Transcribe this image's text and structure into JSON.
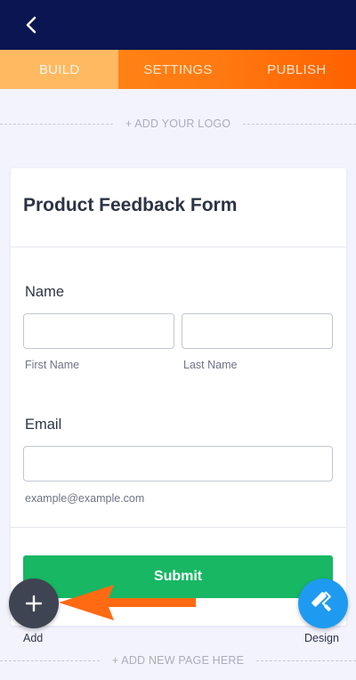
{
  "tabs": [
    {
      "label": "BUILD",
      "active": true
    },
    {
      "label": "SETTINGS",
      "active": false
    },
    {
      "label": "PUBLISH",
      "active": false
    }
  ],
  "logo_placeholder": "+ ADD YOUR LOGO",
  "form": {
    "title": "Product Feedback Form",
    "name_field": {
      "label": "Name",
      "first_value": "",
      "last_value": "",
      "first_sublabel": "First Name",
      "last_sublabel": "Last Name"
    },
    "email_field": {
      "label": "Email",
      "value": "",
      "sublabel": "example@example.com"
    },
    "submit_label": "Submit"
  },
  "fabs": {
    "add_label": "Add",
    "design_label": "Design"
  },
  "new_page_placeholder": "+ ADD NEW PAGE HERE",
  "colors": {
    "header_bg": "#0a1551",
    "tab_gradient_start": "#ff8c1a",
    "tab_gradient_end": "#ff6100",
    "active_tab_bg": "#ffb961",
    "submit_green": "#18b764",
    "add_fab": "#3e4452",
    "design_fab": "#1e9bf0",
    "arrow_orange": "#ff6a13"
  },
  "icons": {
    "back": "back-arrow-icon",
    "add": "plus-icon",
    "design": "paint-roller-icon",
    "pointer": "pointing-arrow-icon"
  }
}
